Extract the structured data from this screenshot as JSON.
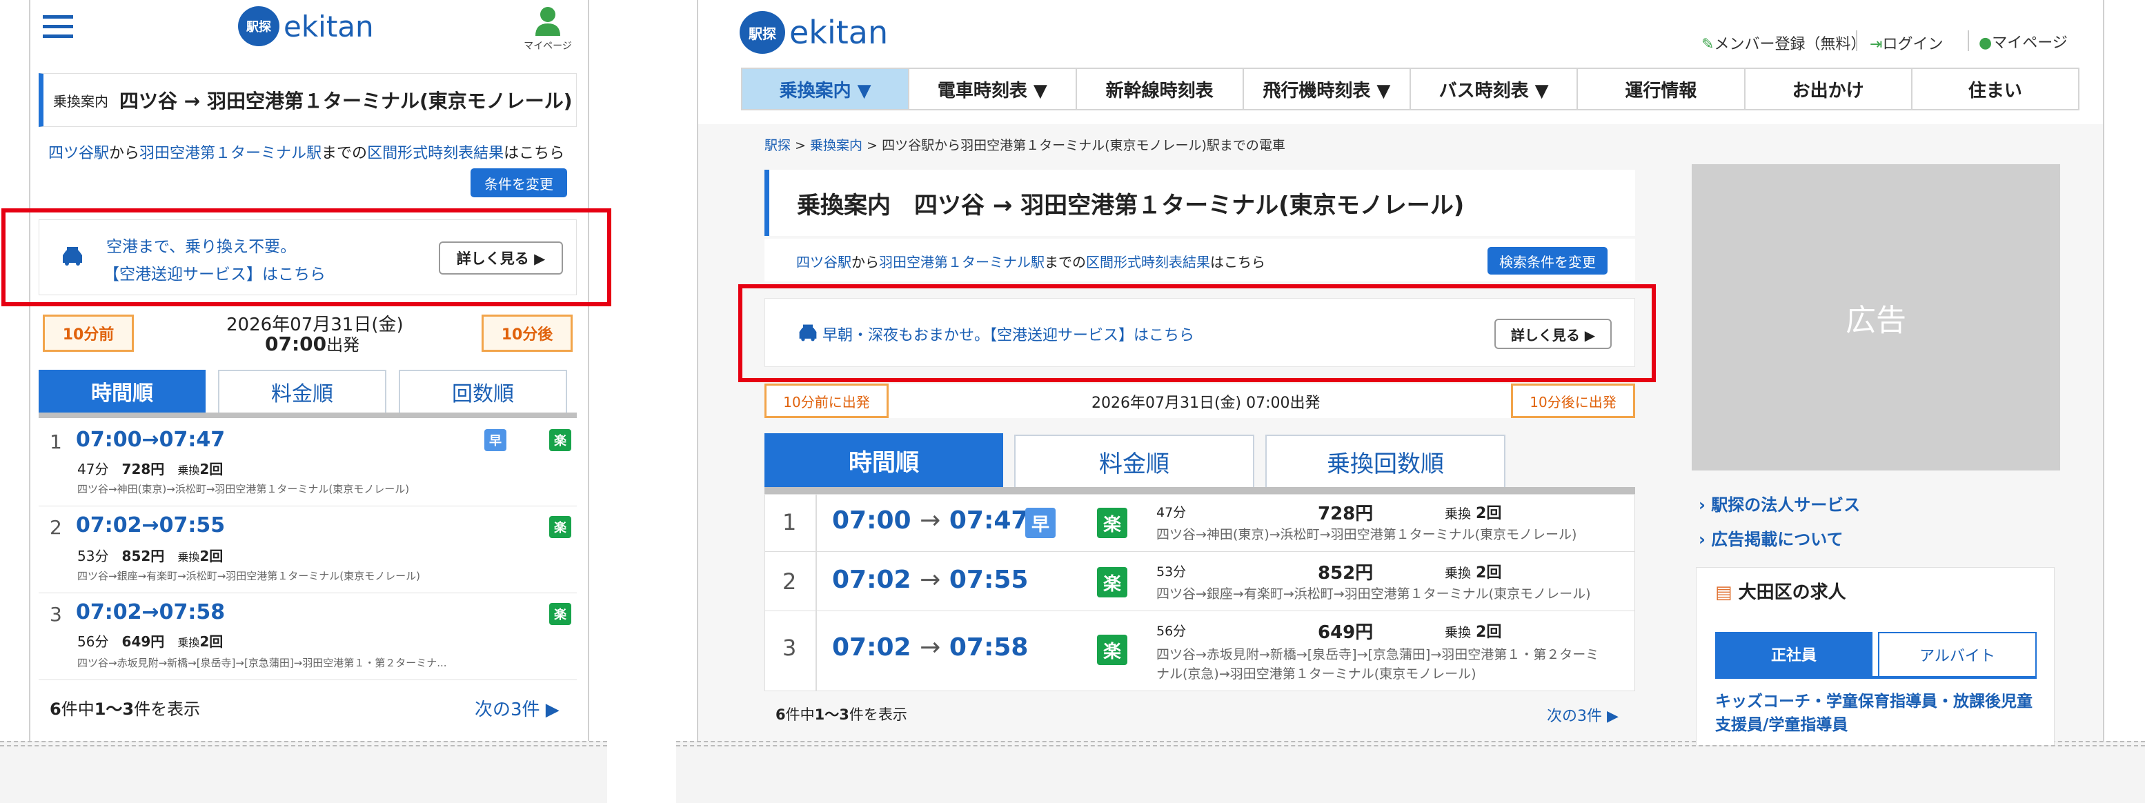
{
  "brand": {
    "name": "ekitan",
    "logo_glyph": "駅探"
  },
  "mobile": {
    "mypage_label": "マイページ",
    "title_prefix": "乗換案内",
    "title_route": "四ツ谷 → 羽田空港第１ターミナル(東京モノレール)",
    "section_link": {
      "from": "四ツ谷駅",
      "mid": "から",
      "to": "羽田空港第１ターミナル駅",
      "mid2": "までの",
      "link3": "区間形式時刻表結果",
      "tail": "はこちら"
    },
    "change_button": "条件を変更",
    "promo": {
      "line1": "空港まで、乗り換え不要。",
      "line2": "【空港送迎サービス】はこちら",
      "button": "詳しく見る ▶"
    },
    "prev_button": "10分前",
    "next_button": "10分後",
    "date": "2026年07月31日(金)",
    "time": "07:00",
    "time_suffix": "出発",
    "tabs": [
      "時間順",
      "料金順",
      "回数順"
    ],
    "results": [
      {
        "no": "1",
        "times": "07:00→07:47",
        "duration": "47分",
        "fare": "728円",
        "transfer_label": "乗換",
        "transfers": "2回",
        "route": "四ツ谷→神田(東京)→浜松町→羽田空港第１ターミナル(東京モノレール)",
        "hayai": "早",
        "raku": "楽"
      },
      {
        "no": "2",
        "times": "07:02→07:55",
        "duration": "53分",
        "fare": "852円",
        "transfer_label": "乗換",
        "transfers": "2回",
        "route": "四ツ谷→銀座→有楽町→浜松町→羽田空港第１ターミナル(東京モノレール)",
        "raku": "楽"
      },
      {
        "no": "3",
        "times": "07:02→07:58",
        "duration": "56分",
        "fare": "649円",
        "transfer_label": "乗換",
        "transfers": "2回",
        "route": "四ツ谷→赤坂見附→新橋→[泉岳寺]→[京急蒲田]→羽田空港第１・第２ターミナ...",
        "raku": "楽"
      }
    ],
    "summary": {
      "count": "6",
      "a": "件中",
      "range": "1～3",
      "b": "件を表示"
    },
    "next_page": "次の3件 ▶"
  },
  "desktop": {
    "header_links": {
      "register": "メンバー登録（無料）",
      "login": "ログイン",
      "mypage": "マイページ"
    },
    "nav": [
      {
        "label": "乗換案内 ▼",
        "active": true
      },
      {
        "label": "電車時刻表 ▼"
      },
      {
        "label": "新幹線時刻表"
      },
      {
        "label": "飛行機時刻表 ▼"
      },
      {
        "label": "バス時刻表 ▼"
      },
      {
        "label": "運行情報"
      },
      {
        "label": "お出かけ"
      },
      {
        "label": "住まい"
      }
    ],
    "breadcrumb": {
      "home": "駅探",
      "sep1": ">",
      "section": "乗換案内",
      "sep2": ">",
      "current": "四ツ谷駅から羽田空港第１ターミナル(東京モノレール)駅までの電車"
    },
    "title": "乗換案内　四ツ谷 → 羽田空港第１ターミナル(東京モノレール)",
    "section_link": {
      "from": "四ツ谷駅",
      "mid": "から",
      "to": "羽田空港第１ターミナル駅",
      "mid2": "までの",
      "link3": "区間形式時刻表結果",
      "tail": "はこちら"
    },
    "change_button": "検索条件を変更",
    "promo": {
      "text": "早朝・深夜もおまかせ。【空港送迎サービス】はこちら",
      "button": "詳しく見る ▶"
    },
    "prev_button": "10分前に出発",
    "next_button": "10分後に出発",
    "datetime": "2026年07月31日(金) 07:00出発",
    "tabs": [
      "時間順",
      "料金順",
      "乗換回数順"
    ],
    "results": [
      {
        "no": "1",
        "dep": "07:00",
        "arr": "07:47",
        "hayai": "早",
        "raku": "楽",
        "duration": "47分",
        "fare": "728円",
        "transfer_label": "乗換",
        "transfers": "2回",
        "route": "四ツ谷→神田(東京)→浜松町→羽田空港第１ターミナル(東京モノレール)"
      },
      {
        "no": "2",
        "dep": "07:02",
        "arr": "07:55",
        "raku": "楽",
        "duration": "53分",
        "fare": "852円",
        "transfer_label": "乗換",
        "transfers": "2回",
        "route": "四ツ谷→銀座→有楽町→浜松町→羽田空港第１ターミナル(東京モノレール)"
      },
      {
        "no": "3",
        "dep": "07:02",
        "arr": "07:58",
        "raku": "楽",
        "duration": "56分",
        "fare": "649円",
        "transfer_label": "乗換",
        "transfers": "2回",
        "route1": "四ツ谷→赤坂見附→新橋→[泉岳寺]→[京急蒲田]→羽田空港第１・第２ターミ",
        "route2": "ナル(京急)→羽田空港第１ターミナル(東京モノレール)"
      }
    ],
    "summary": {
      "count": "6",
      "a": "件中",
      "range": "1～3",
      "b": "件を表示"
    },
    "next_page": "次の3件 ▶",
    "ad_label": "広告",
    "side_links": [
      "駅探の法人サービス",
      "広告掲載について"
    ],
    "jobs": {
      "title": "大田区の求人",
      "tabs": [
        "正社員",
        "アルバイト"
      ],
      "listing": "キッズコーチ・学童保育指導員・放課後児童支援員/学童指導員"
    }
  },
  "colors": {
    "accent": "#1f72d6",
    "highlight": "#e60012",
    "raku": "#17a34a",
    "hayai": "#4f95e8",
    "orange": "#e0620c"
  }
}
